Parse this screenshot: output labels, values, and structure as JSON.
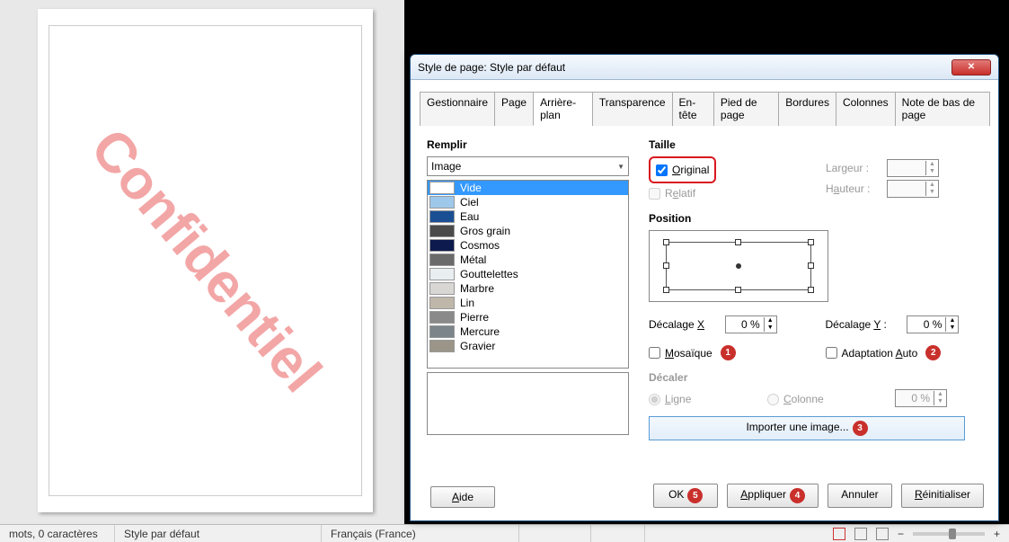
{
  "watermark": "Confidentiel",
  "statusbar": {
    "words": "mots, 0 caractères",
    "style": "Style par défaut",
    "lang": "Français (France)"
  },
  "dialog": {
    "title": "Style de page: Style par défaut",
    "tabs": [
      "Gestionnaire",
      "Page",
      "Arrière-plan",
      "Transparence",
      "En-tête",
      "Pied de page",
      "Bordures",
      "Colonnes",
      "Note de bas de page"
    ],
    "active_tab": 2,
    "fill_label": "Remplir",
    "fill_combo": "Image",
    "fill_items": [
      "Vide",
      "Ciel",
      "Eau",
      "Gros grain",
      "Cosmos",
      "Métal",
      "Gouttelettes",
      "Marbre",
      "Lin",
      "Pierre",
      "Mercure",
      "Gravier"
    ],
    "fill_colors": [
      "#ffffff",
      "#9ec8ea",
      "#1a4f93",
      "#4a4a4a",
      "#0c1a4d",
      "#6a6a6a",
      "#e9eef1",
      "#d9d7d4",
      "#bfb7aa",
      "#8a8a8a",
      "#7c8589",
      "#9a9588"
    ],
    "size_label": "Taille",
    "original": "Original",
    "relatif": "Relatif",
    "largeur": "Largeur :",
    "hauteur": "Hauteur :",
    "position_label": "Position",
    "decalage_x": "Décalage X",
    "decalage_y": "Décalage Y :",
    "dx_val": "0 %",
    "dy_val": "0 %",
    "mosaique": "Mosaïque",
    "adapt": "Adaptation Auto",
    "decaler": "Décaler",
    "ligne": "Ligne",
    "colonne": "Colonne",
    "decaler_val": "0 %",
    "import": "Importer une image...",
    "help": "Aide",
    "ok": "OK",
    "apply": "Appliquer",
    "cancel": "Annuler",
    "reset": "Réinitialiser",
    "badges": {
      "mosaique": "1",
      "adapt": "2",
      "import": "3",
      "apply": "4",
      "ok": "5"
    }
  }
}
